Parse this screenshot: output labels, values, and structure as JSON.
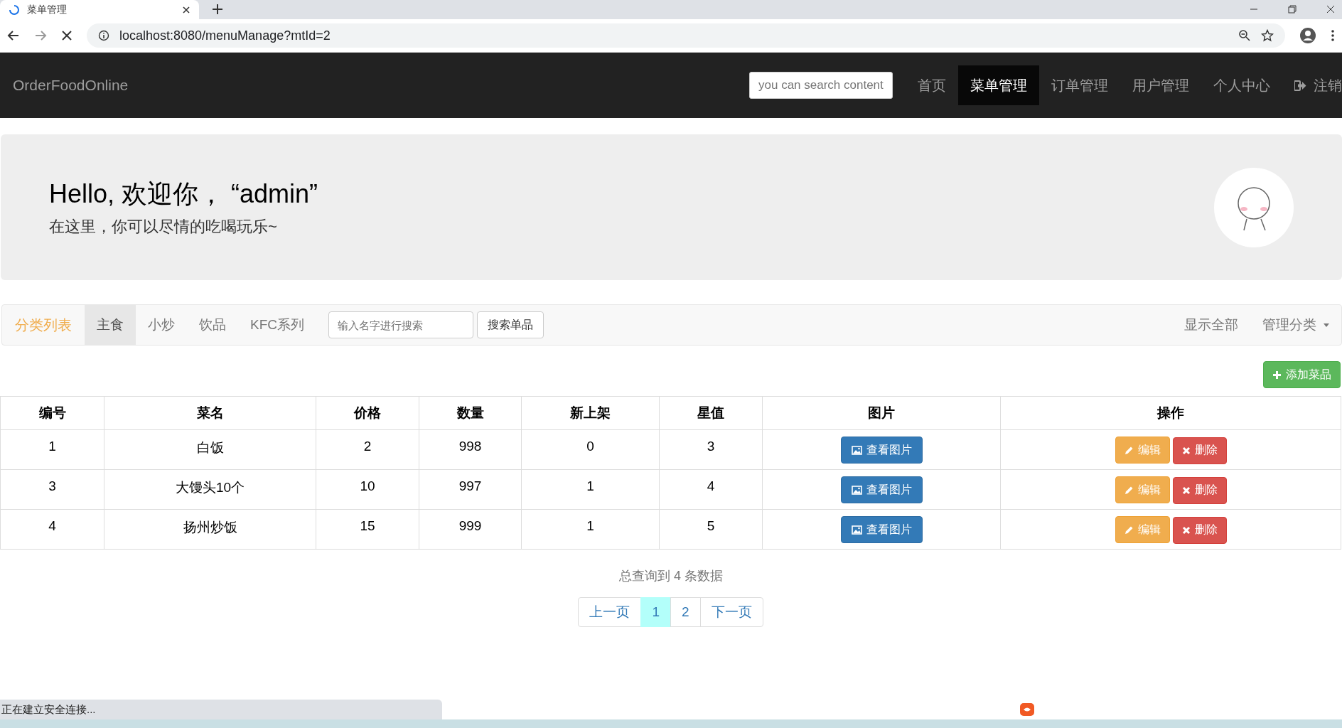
{
  "browser": {
    "tab_title": "菜单管理",
    "url": "localhost:8080/menuManage?mtId=2"
  },
  "navbar": {
    "brand": "OrderFoodOnline",
    "search": {
      "placeholder": "you can search content"
    },
    "items": [
      {
        "label": "首页",
        "selected": false
      },
      {
        "label": "菜单管理",
        "selected": true
      },
      {
        "label": "订单管理",
        "selected": false
      },
      {
        "label": "用户管理",
        "selected": false
      },
      {
        "label": "个人中心",
        "selected": false
      }
    ],
    "logout": "注销"
  },
  "jumbotron": {
    "title": "Hello, 欢迎你， “admin”",
    "subtitle": "在这里，你可以尽情的吃喝玩乐~"
  },
  "category_nav": {
    "title": "分类列表",
    "tabs": [
      {
        "label": "主食",
        "selected": true
      },
      {
        "label": "小炒",
        "selected": false
      },
      {
        "label": "饮品",
        "selected": false
      },
      {
        "label": "KFC系列",
        "selected": false
      }
    ],
    "search": {
      "placeholder": "输入名字进行搜索"
    },
    "search_button": "搜索单品",
    "show_all": "显示全部",
    "manage": "管理分类"
  },
  "add_button": "添加菜品",
  "table": {
    "columns": [
      "编号",
      "菜名",
      "价格",
      "数量",
      "新上架",
      "星值",
      "图片",
      "操作"
    ],
    "rows": [
      {
        "cells": [
          "1",
          "白饭",
          "2",
          "998",
          "0",
          "3"
        ],
        "view": "查看图片",
        "edit": "编辑",
        "delete": "删除"
      },
      {
        "cells": [
          "3",
          "大馒头10个",
          "10",
          "997",
          "1",
          "4"
        ],
        "view": "查看图片",
        "edit": "编辑",
        "delete": "删除"
      },
      {
        "cells": [
          "4",
          "扬州炒饭",
          "15",
          "999",
          "1",
          "5"
        ],
        "view": "查看图片",
        "edit": "编辑",
        "delete": "删除"
      }
    ]
  },
  "summary": "总查询到 4 条数据",
  "pagination": {
    "prev": "上一页",
    "pages": [
      {
        "label": "1",
        "selected": true
      },
      {
        "label": "2",
        "selected": false
      }
    ],
    "next": "下一页"
  },
  "status_bar": "正在建立安全连接..."
}
